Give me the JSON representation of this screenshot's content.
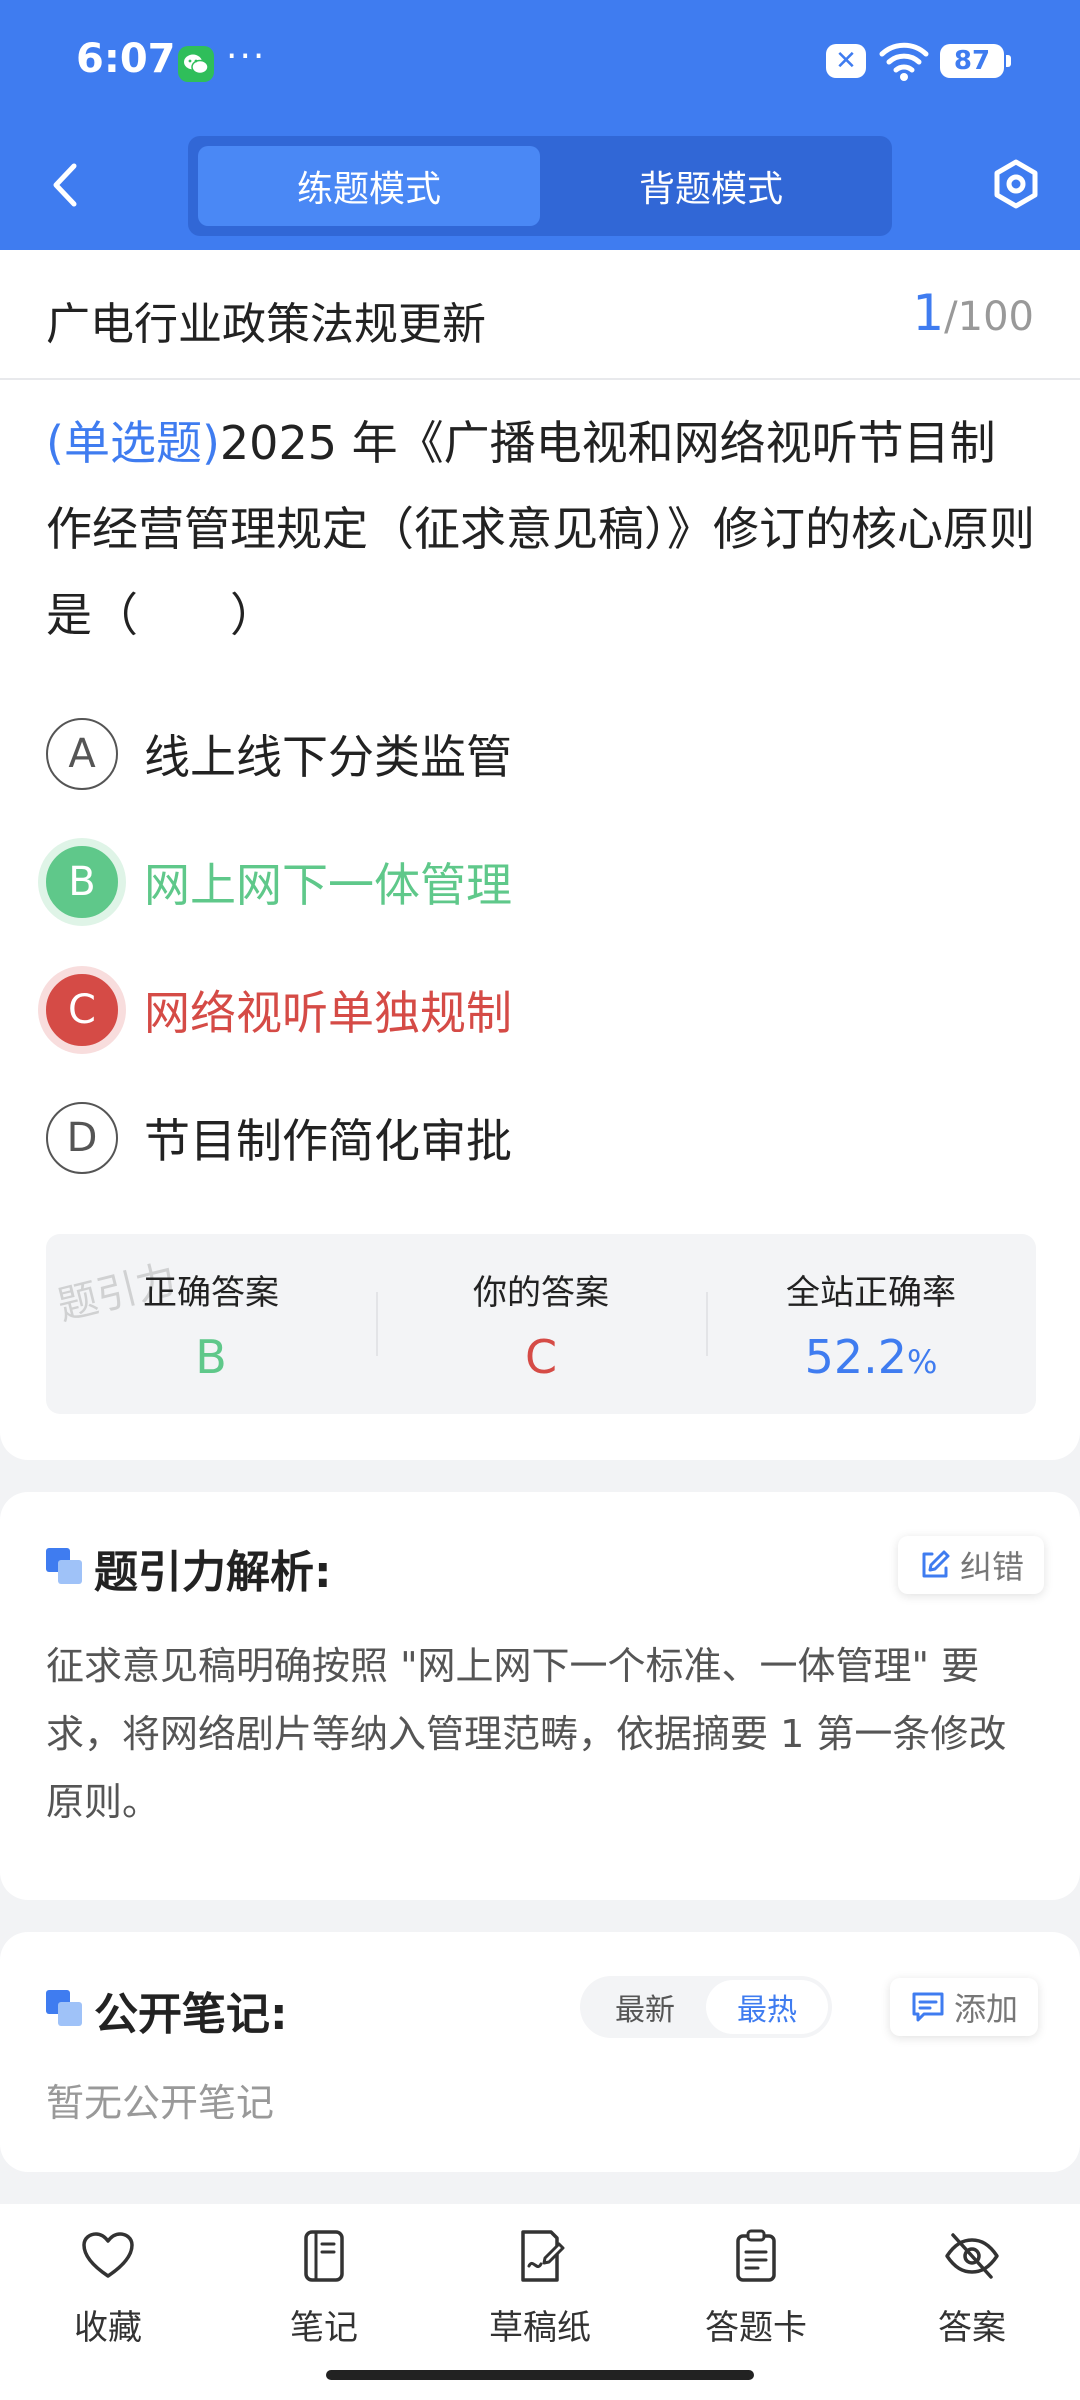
{
  "status_bar": {
    "time": "6:07",
    "dots": "···",
    "battery": "87"
  },
  "header": {
    "tabs": [
      {
        "label": "练题模式",
        "active": true
      },
      {
        "label": "背题模式",
        "active": false
      }
    ]
  },
  "question_card": {
    "category": "广电行业政策法规更新",
    "counter": {
      "current": "1",
      "total": "/100"
    },
    "question": {
      "type_label": "(单选题)",
      "text": "2025 年《广播电视和网络视听节目制作经营管理规定（征求意见稿）》修订的核心原则是（　　）"
    },
    "options": [
      {
        "letter": "A",
        "text": "线上线下分类监管",
        "state": "normal"
      },
      {
        "letter": "B",
        "text": "网上网下一体管理",
        "state": "correct"
      },
      {
        "letter": "C",
        "text": "网络视听单独规制",
        "state": "wrong"
      },
      {
        "letter": "D",
        "text": "节目制作简化审批",
        "state": "normal"
      }
    ],
    "stats": {
      "correct_answer": {
        "title": "正确答案",
        "value": "B"
      },
      "your_answer": {
        "title": "你的答案",
        "value": "C"
      },
      "accuracy": {
        "title": "全站正确率",
        "value": "52.2",
        "unit": "%"
      }
    },
    "watermark": "题引力"
  },
  "analysis": {
    "title": "题引力解析:",
    "report_label": "纠错",
    "text": "征求意见稿明确按照 \"网上网下一个标准、一体管理\" 要求，将网络剧片等纳入管理范畴，依据摘要 1 第一条修改原则。"
  },
  "notes": {
    "title": "公开笔记:",
    "sort_options": [
      {
        "label": "最新",
        "active": false
      },
      {
        "label": "最热",
        "active": true
      }
    ],
    "add_label": "添加",
    "empty_text": "暂无公开笔记"
  },
  "bottom_bar": [
    {
      "label": "收藏",
      "icon": "heart-icon"
    },
    {
      "label": "笔记",
      "icon": "notebook-icon"
    },
    {
      "label": "草稿纸",
      "icon": "draft-icon"
    },
    {
      "label": "答题卡",
      "icon": "clipboard-icon"
    },
    {
      "label": "答案",
      "icon": "eye-off-icon"
    }
  ],
  "colors": {
    "primary": "#3f7cf0",
    "correct": "#5fc88a",
    "wrong": "#d54b46"
  }
}
